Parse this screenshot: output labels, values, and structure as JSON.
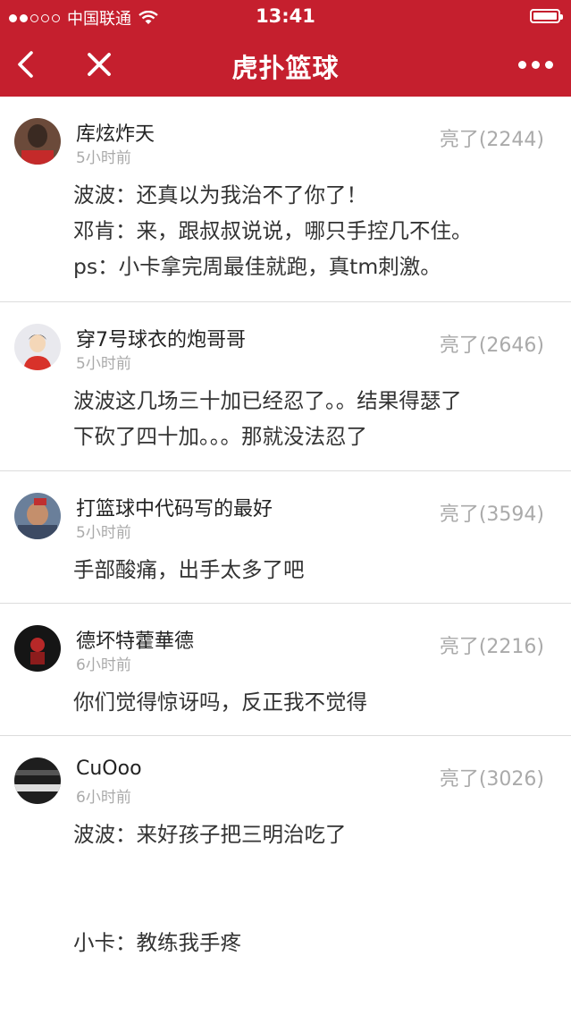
{
  "status": {
    "carrier": "中国联通",
    "time": "13:41"
  },
  "nav": {
    "title": "虎扑篮球"
  },
  "comments": [
    {
      "user": "库炫炸天",
      "time": "5小时前",
      "light": "亮了(2244)",
      "lines": [
        "波波：还真以为我治不了你了！",
        "邓肯：来，跟叔叔说说，哪只手控几不住。",
        "ps：小卡拿完周最佳就跑，真tm刺激。"
      ]
    },
    {
      "user": "穿7号球衣的炮哥哥",
      "time": "5小时前",
      "light": "亮了(2646)",
      "lines": [
        "波波这几场三十加已经忍了。。结果得瑟了",
        "下砍了四十加。。。那就没法忍了"
      ]
    },
    {
      "user": "打篮球中代码写的最好",
      "time": "5小时前",
      "light": "亮了(3594)",
      "lines": [
        "手部酸痛，出手太多了吧"
      ]
    },
    {
      "user": "德坏特藿華德",
      "time": "6小时前",
      "light": "亮了(2216)",
      "lines": [
        "你们觉得惊讶吗，反正我不觉得"
      ]
    },
    {
      "user": "CuOoo",
      "time": "6小时前",
      "light": "亮了(3026)",
      "lines": [
        "波波：来好孩子把三明治吃了",
        "",
        "",
        "小卡：教练我手疼"
      ]
    }
  ]
}
